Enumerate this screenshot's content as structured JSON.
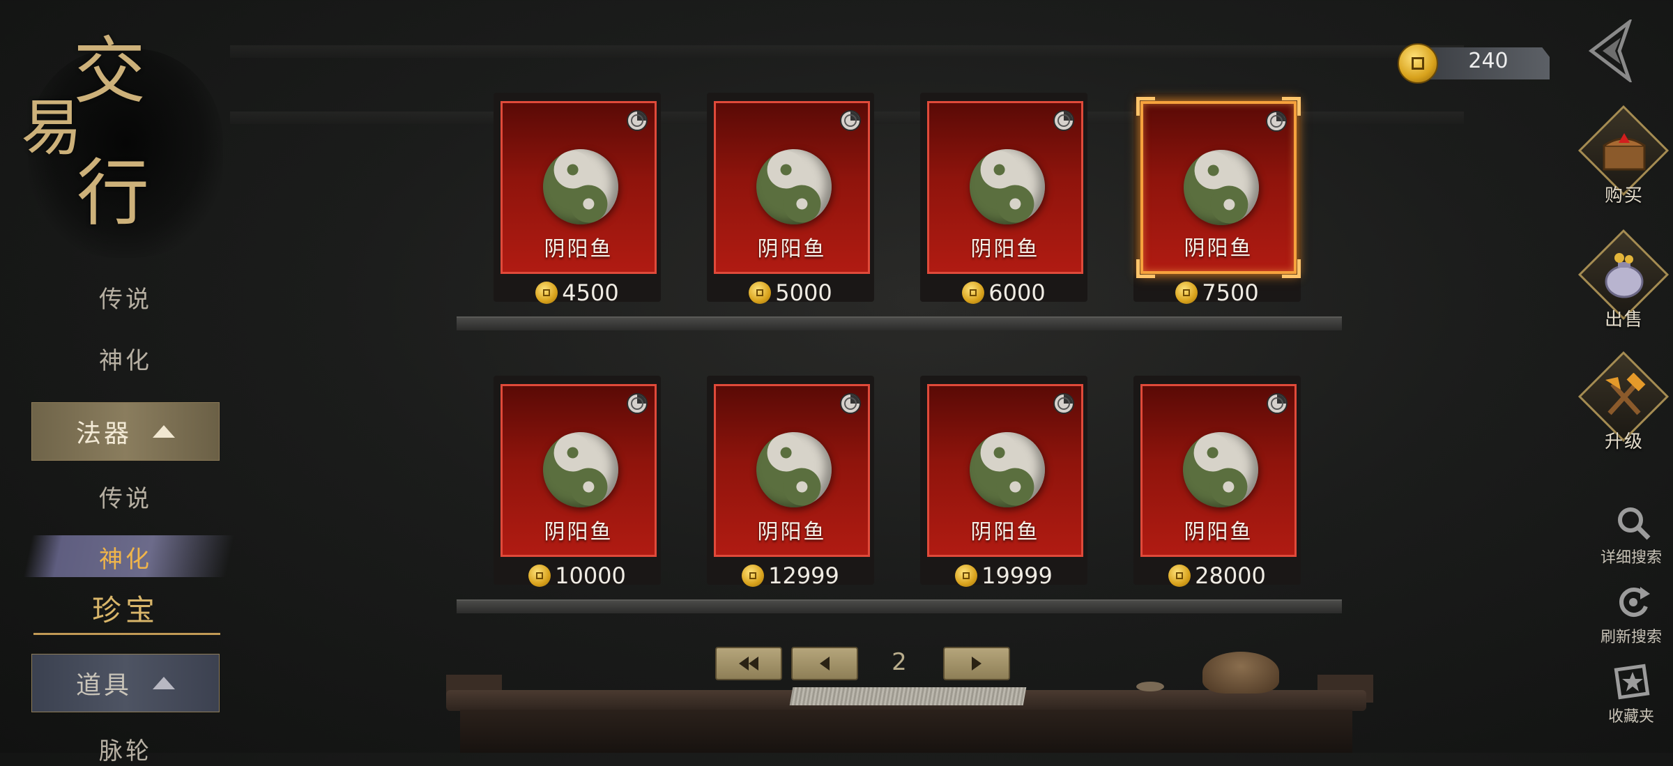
{
  "title": {
    "chars": [
      "交",
      "易",
      "行"
    ]
  },
  "left_nav": {
    "items": [
      {
        "label": "传说"
      },
      {
        "label": "神化"
      },
      {
        "label": "法器"
      },
      {
        "label": "传说"
      },
      {
        "label": "神化"
      },
      {
        "label": "珍宝"
      },
      {
        "label": "道具"
      },
      {
        "label": "脉轮"
      }
    ]
  },
  "currency": {
    "value": "240",
    "icon": "coin-icon"
  },
  "cards": [
    {
      "name": "阴阳鱼",
      "price": "4500"
    },
    {
      "name": "阴阳鱼",
      "price": "5000"
    },
    {
      "name": "阴阳鱼",
      "price": "6000"
    },
    {
      "name": "阴阳鱼",
      "price": "7500",
      "selected": true
    },
    {
      "name": "阴阳鱼",
      "price": "10000"
    },
    {
      "name": "阴阳鱼",
      "price": "12999"
    },
    {
      "name": "阴阳鱼",
      "price": "19999"
    },
    {
      "name": "阴阳鱼",
      "price": "28000"
    }
  ],
  "pagination": {
    "page": "2"
  },
  "right_sidebar": {
    "buy": "购买",
    "sell": "出售",
    "upgrade": "升级",
    "detail_search": "详细搜索",
    "refresh_search": "刷新搜索",
    "favorites": "收藏夹"
  },
  "colors": {
    "card_red": "#b01b12",
    "card_border": "#e04a3a",
    "selected_glow": "#f6a23d",
    "gold_text": "#d9b66a"
  }
}
